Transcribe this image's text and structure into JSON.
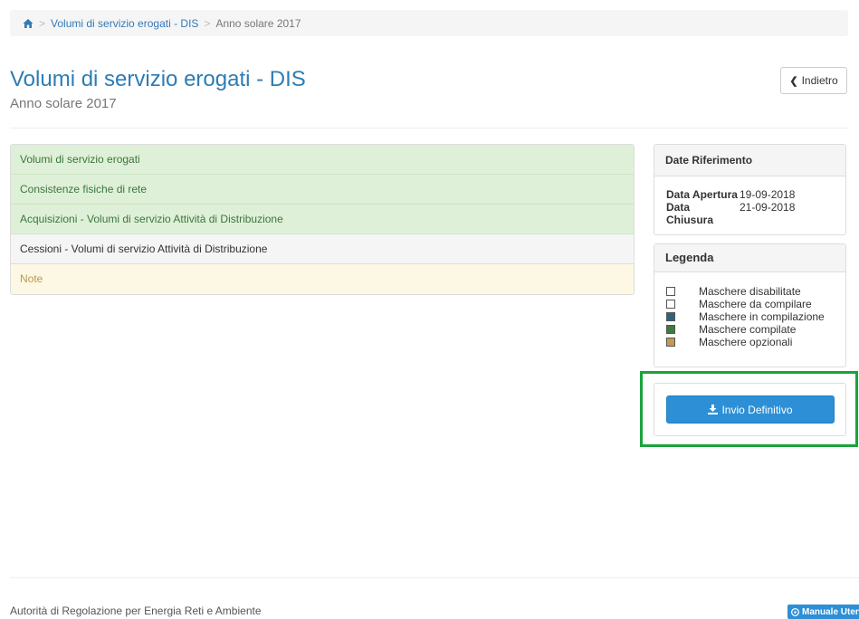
{
  "breadcrumb": {
    "icon": "home-icon",
    "link": "Volumi di servizio erogati - DIS",
    "separator": ">",
    "current": "Anno solare 2017"
  },
  "header": {
    "title": "Volumi di servizio erogati - DIS",
    "subtitle": "Anno solare 2017",
    "back_label": "Indietro",
    "back_icon": "chevron-left-icon"
  },
  "sections": [
    {
      "label": "Volumi di servizio erogati",
      "state": "compilate",
      "color": "#dff0d8"
    },
    {
      "label": "Consistenze fisiche di rete",
      "state": "compilate",
      "color": "#dff0d8"
    },
    {
      "label": "Acquisizioni - Volumi di servizio Attività  di Distribuzione",
      "state": "compilate",
      "color": "#dff0d8"
    },
    {
      "label": "Cessioni - Volumi di servizio Attività  di Distribuzione",
      "state": "da compilare",
      "color": "#f5f5f5"
    },
    {
      "label": "Note",
      "state": "opzionali",
      "color": "#fcf8e3"
    }
  ],
  "dates_panel": {
    "title": "Date Riferimento",
    "rows": [
      {
        "label": "Data Apertura",
        "value": "19-09-2018"
      },
      {
        "label": "Data Chiusura",
        "value": "21-09-2018"
      }
    ]
  },
  "legend_panel": {
    "title": "Legenda",
    "items": [
      {
        "label": "Maschere disabilitate",
        "color": "#ffffff"
      },
      {
        "label": "Maschere da compilare",
        "color": "#ffffff"
      },
      {
        "label": "Maschere in compilazione",
        "color": "#2f6380"
      },
      {
        "label": "Maschere compilate",
        "color": "#3f7a3f"
      },
      {
        "label": "Maschere opzionali",
        "color": "#c49a52"
      }
    ]
  },
  "actions": {
    "submit_label": "Invio Definitivo",
    "submit_icon": "download-icon",
    "accent": "#2d8fd6",
    "highlight_color": "#1aa33a"
  },
  "footer": {
    "text": "Autorità di Regolazione per Energia Reti e Ambiente",
    "manual_label": "Manuale Utente",
    "manual_icon": "help-circle-icon"
  }
}
